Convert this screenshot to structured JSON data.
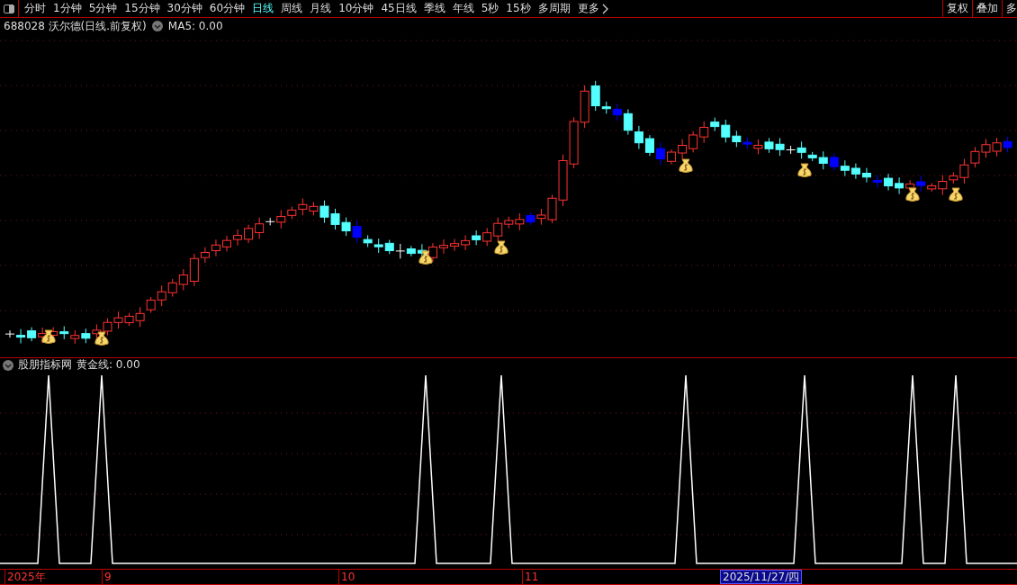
{
  "toolbar": {
    "tabs": [
      {
        "label": "分时",
        "selected": false
      },
      {
        "label": "1分钟",
        "selected": false
      },
      {
        "label": "5分钟",
        "selected": false
      },
      {
        "label": "15分钟",
        "selected": false
      },
      {
        "label": "30分钟",
        "selected": false
      },
      {
        "label": "60分钟",
        "selected": false
      },
      {
        "label": "日线",
        "selected": true
      },
      {
        "label": "周线",
        "selected": false
      },
      {
        "label": "月线",
        "selected": false
      },
      {
        "label": "10分钟",
        "selected": false
      },
      {
        "label": "45日线",
        "selected": false
      },
      {
        "label": "季线",
        "selected": false
      },
      {
        "label": "年线",
        "selected": false
      },
      {
        "label": "5秒",
        "selected": false
      },
      {
        "label": "15秒",
        "selected": false
      },
      {
        "label": "多周期",
        "selected": false
      }
    ],
    "more": "更多",
    "right_buttons": [
      "复权",
      "叠加",
      "多"
    ]
  },
  "main_chart": {
    "title": "688028 沃尔德(日线.前复权)",
    "indicator": "MA5: 0.00"
  },
  "sub_chart": {
    "title": "股朋指标网",
    "indicator": "黄金线: 0.00"
  },
  "time_axis": {
    "labels": [
      "2025年",
      "9",
      "10",
      "11"
    ],
    "cursor_date": "2025/11/27/四"
  }
}
